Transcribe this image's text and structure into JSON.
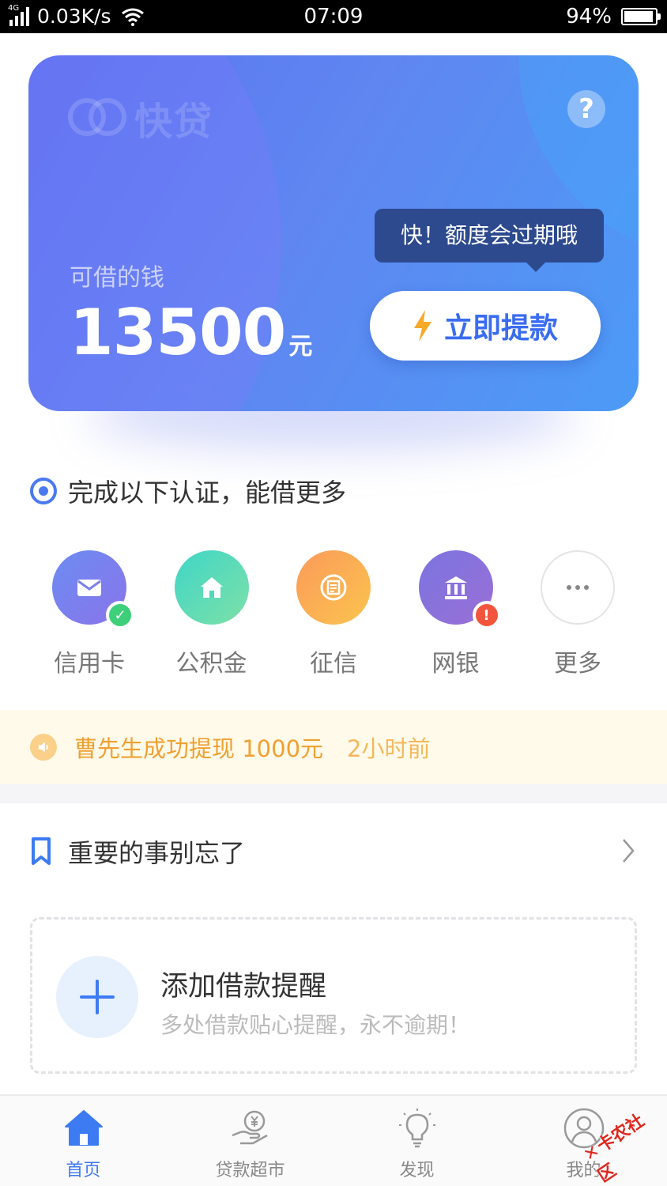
{
  "status_bar": {
    "net_type": "4G",
    "speed": "0.03K/s",
    "time": "07:09",
    "battery_text": "94%",
    "battery_level": 0.94
  },
  "hero": {
    "logo_text": "快贷",
    "help_icon": "?",
    "available_label": "可借的钱",
    "amount": "13500",
    "amount_unit": "元",
    "tooltip": "快！额度会过期哦",
    "withdraw_label": "立即提款"
  },
  "verify": {
    "title": "完成以下认证，能借更多",
    "items": [
      {
        "label": "信用卡",
        "icon": "envelope-icon",
        "status": "done"
      },
      {
        "label": "公积金",
        "icon": "home-icon",
        "status": "none"
      },
      {
        "label": "征信",
        "icon": "credit-report-icon",
        "status": "none"
      },
      {
        "label": "网银",
        "icon": "bank-icon",
        "status": "warning",
        "badge": "!"
      },
      {
        "label": "更多",
        "icon": "more-dots-icon",
        "status": "none"
      }
    ]
  },
  "notice": {
    "message": "曹先生成功提现 1000元",
    "time_ago": "2小时前"
  },
  "reminder": {
    "section_title": "重要的事别忘了",
    "add_title": "添加借款提醒",
    "add_subtitle": "多处借款贴心提醒，永不逾期！"
  },
  "tabs": [
    {
      "label": "首页",
      "icon": "home-tab-icon",
      "active": true
    },
    {
      "label": "贷款超市",
      "icon": "loan-market-icon",
      "active": false
    },
    {
      "label": "发现",
      "icon": "bulb-icon",
      "active": false
    },
    {
      "label": "我的",
      "icon": "user-icon",
      "active": false
    }
  ],
  "watermark": "卡农社区",
  "colors": {
    "accent": "#3d7bf2",
    "card_gradient_start": "#5a74f0",
    "card_gradient_end": "#4c9bf6",
    "tooltip_bg": "#2d4a8f",
    "notice_text": "#f0a030",
    "success": "#3ecf7a",
    "warning": "#f2553d"
  }
}
